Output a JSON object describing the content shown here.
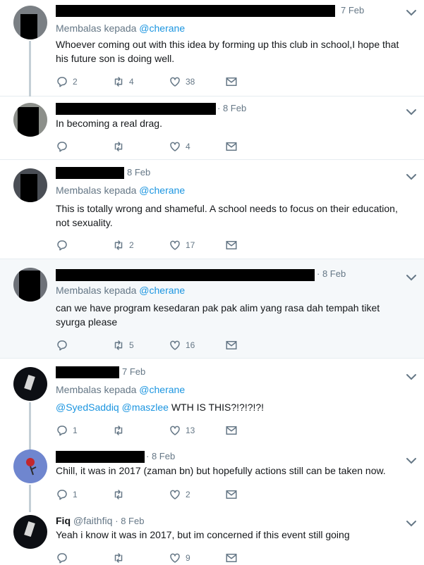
{
  "reply_prefix": "Membalas kepada",
  "tweets": [
    {
      "time": "7 Feb",
      "reply_to": "@cherane",
      "text": "Whoever coming out with this idea by forming up this club in school,I hope that his future son is doing well.",
      "replies": "2",
      "retweets": "4",
      "likes": "38"
    },
    {
      "time": "· 8 Feb",
      "text": "In becoming a real drag.",
      "replies": "",
      "retweets": "",
      "likes": "4"
    },
    {
      "time": "8 Feb",
      "reply_to": "@cherane",
      "text": "This is totally wrong and shameful. A school needs to focus on their education, not sexuality.",
      "replies": "",
      "retweets": "2",
      "likes": "17"
    },
    {
      "time": "· 8 Feb",
      "reply_to": "@cherane",
      "text": "can we have program kesedaran pak pak alim yang rasa dah tempah tiket syurga please",
      "replies": "",
      "retweets": "5",
      "likes": "16"
    },
    {
      "time": "7 Feb",
      "reply_to": "@cherane",
      "mention1": "@SyedSaddiq",
      "mention2": "@maszlee",
      "text": "WTH IS THIS?!?!?!?!",
      "replies": "1",
      "retweets": "",
      "likes": "13"
    },
    {
      "time": "· 8 Feb",
      "text": "Chill, it was in 2017 (zaman bn) but hopefully actions still can be taken now.",
      "replies": "1",
      "retweets": "",
      "likes": "2"
    },
    {
      "name": "Fiq",
      "handle": "@faithfiq",
      "time": "· 8 Feb",
      "text": "Yeah i know it was in 2017, but im concerned if this event still going",
      "replies": "",
      "retweets": "",
      "likes": "9"
    }
  ],
  "colors": {
    "link": "#1b95e0",
    "muted": "#657786",
    "divider": "#e6ecf0",
    "highlight": "#f5f8fa"
  },
  "icons": [
    "reply-icon",
    "retweet-icon",
    "like-icon",
    "dm-icon",
    "chevron-down-icon"
  ]
}
